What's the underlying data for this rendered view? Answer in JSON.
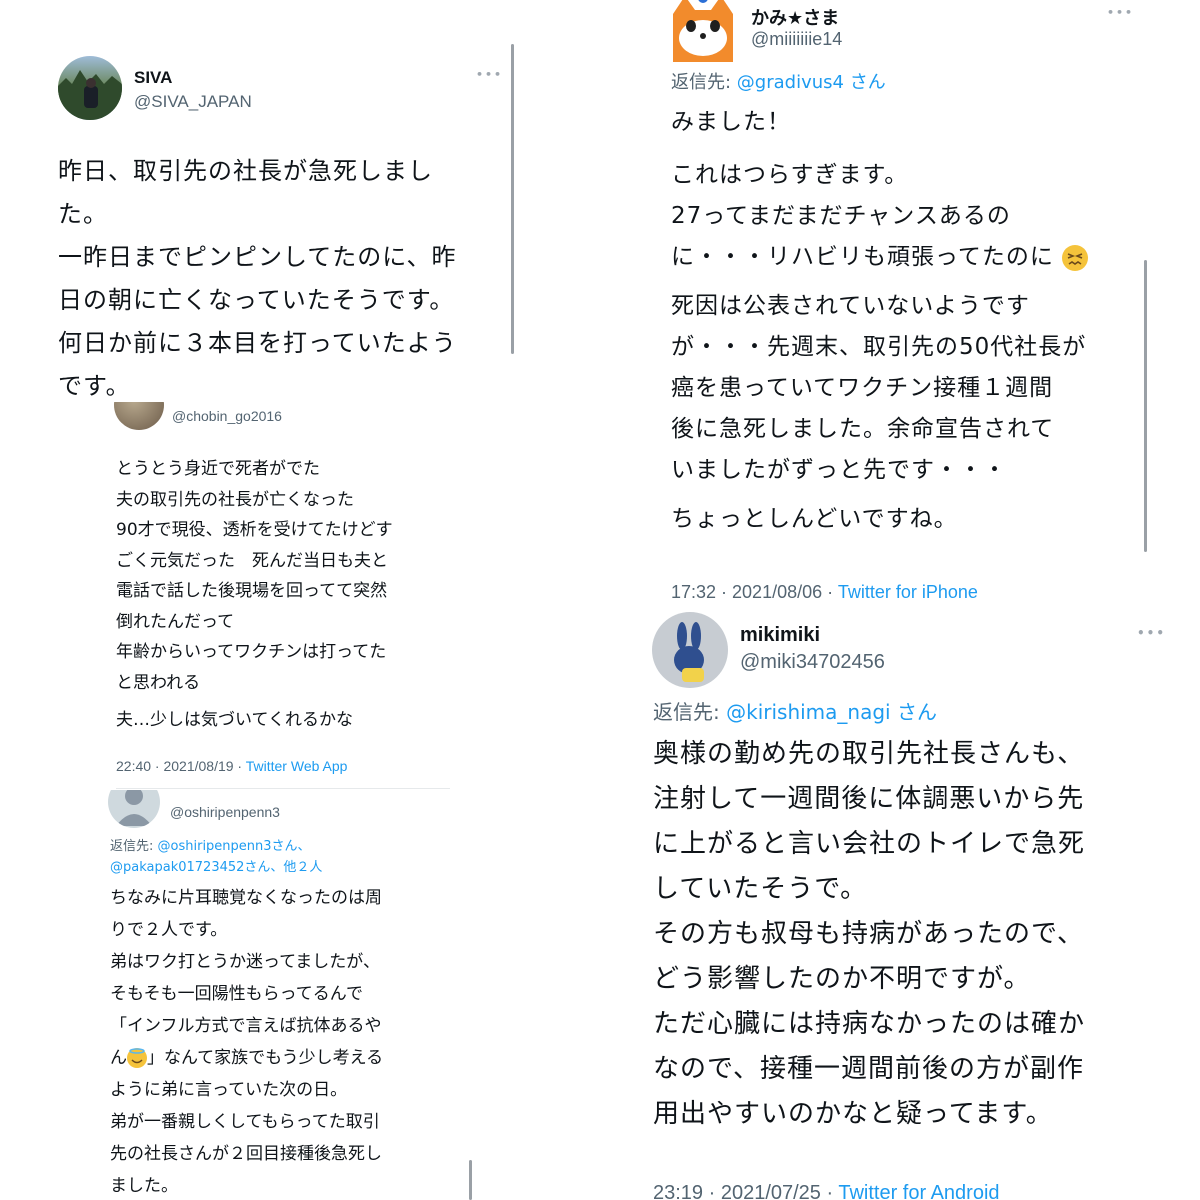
{
  "tweet_siva": {
    "name": "SIVA",
    "handle": "@SIVA_JAPAN",
    "more": "•••",
    "lines": [
      "昨日、取引先の社長が急死しまし",
      "た。",
      "一昨日までピンピンしてたのに、昨",
      "日の朝に亡くなっていたそうです。",
      "何日か前に３本目を打っていたよう",
      "です。"
    ]
  },
  "tweet_chobin": {
    "handle": "@chobin_go2016",
    "lines": [
      "とうとう身近で死者がでた",
      "夫の取引先の社長が亡くなった",
      "90才で現役、透析を受けてたけどす",
      "ごく元気だった　死んだ当日も夫と",
      "電話で話した後現場を回ってて突然",
      "倒れたんだって",
      "年齢からいってワクチンは打ってた",
      "と思われる"
    ],
    "last_line": "夫…少しは気づいてくれるかな",
    "timestamp": "22:40 · 2021/08/19 · ",
    "client": "Twitter Web App"
  },
  "tweet_oshiri": {
    "handle": "@oshiripenpenn3",
    "reply_prefix": "返信先: ",
    "reply_to_1": "@oshiripenpenn3さん、",
    "reply_to_2": "@pakapak01723452さん、他２人",
    "lines": [
      "ちなみに片耳聴覚なくなったのは周",
      "りで２人です。",
      "弟はワク打とうか迷ってましたが、",
      "そもそも一回陽性もらってるんで",
      "「インフル方式で言えば抗体あるや"
    ],
    "line_emoji_before": "ん",
    "line_emoji_after": "」なんて家族でもう少し考える",
    "lines_after": [
      "ように弟に言っていた次の日。",
      "弟が一番親しくしてもらってた取引",
      "先の社長さんが２回目接種後急死し",
      "ました。"
    ]
  },
  "tweet_kami": {
    "name": "かみ★さま",
    "handle": "@miiiiiiie14",
    "more": "•••",
    "reply_prefix": "返信先: ",
    "reply_to": "@gradivus4 さん",
    "p1": "みました！",
    "p2_lines": [
      "これはつらすぎます。",
      "27ってまだまだチャンスあるの"
    ],
    "p2_last": "に・・・リハビリも頑張ってたのに",
    "p3_lines": [
      "死因は公表されていないようです",
      "が・・・先週末、取引先の50代社長が",
      "癌を患っていてワクチン接種１週間",
      "後に急死しました。余命宣告されて",
      "いましたがずっと先です・・・"
    ],
    "p4": "ちょっとしんどいですね。",
    "timestamp": "17:32 · 2021/08/06 · ",
    "client": "Twitter for iPhone"
  },
  "tweet_miki": {
    "name": "mikimiki",
    "handle": "@miki34702456",
    "more": "•••",
    "reply_prefix": "返信先: ",
    "reply_to": "@kirishima_nagi さん",
    "lines": [
      "奥様の勤め先の取引先社長さんも、",
      "注射して一週間後に体調悪いから先",
      "に上がると言い会社のトイレで急死",
      "していたそうで。",
      "その方も叔母も持病があったので、",
      "どう影響したのか不明ですが。",
      "ただ心臓には持病なかったのは確か",
      "なので、接種一週間前後の方が副作",
      "用出やすいのかなと疑ってます。"
    ],
    "timestamp": "23:19 · 2021/07/25 · ",
    "client": "Twitter for Android"
  },
  "colors": {
    "link": "#1d9bf0",
    "secondary_text": "#536471",
    "primary_text": "#0f1419"
  }
}
